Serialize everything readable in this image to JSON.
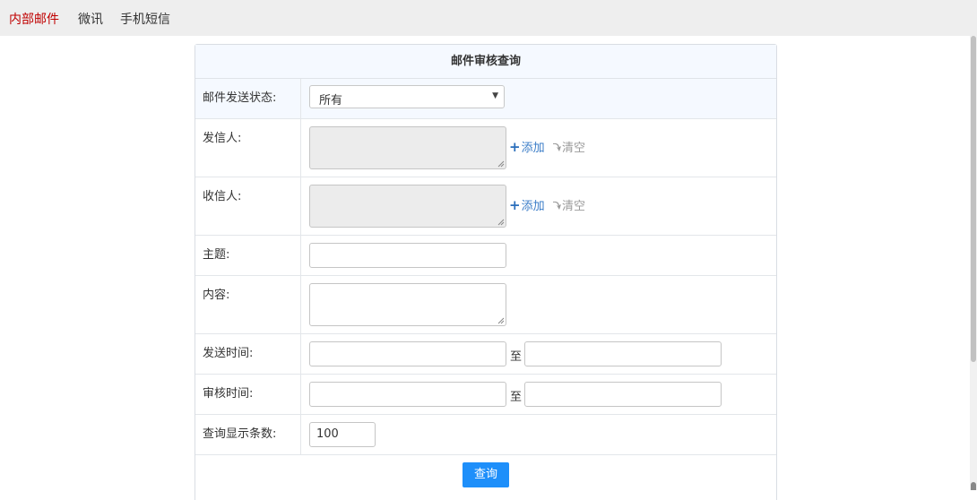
{
  "tabs": [
    {
      "label": "内部邮件",
      "active": true
    },
    {
      "label": "微讯",
      "active": false
    },
    {
      "label": "手机短信",
      "active": false
    }
  ],
  "form": {
    "title": "邮件审核查询",
    "status": {
      "label": "邮件发送状态:",
      "selected": "所有"
    },
    "sender": {
      "label": "发信人:",
      "add": "添加",
      "clear": "清空"
    },
    "receiver": {
      "label": "收信人:",
      "add": "添加",
      "clear": "清空"
    },
    "subject": {
      "label": "主题:",
      "value": ""
    },
    "content": {
      "label": "内容:",
      "value": ""
    },
    "send_time": {
      "label": "发送时间:",
      "to": "至",
      "from_value": "",
      "to_value": ""
    },
    "audit_time": {
      "label": "审核时间:",
      "to": "至",
      "from_value": "",
      "to_value": ""
    },
    "count": {
      "label": "查询显示条数:",
      "value": "100"
    },
    "query_button": "查询"
  },
  "colors": {
    "active_tab": "#c00000",
    "link": "#3a7cc7",
    "primary_button": "#1e8ffa",
    "header_bg": "#f5f9ff"
  },
  "icons": {
    "add": "plus-icon",
    "clear": "curved-arrow-icon",
    "select": "caret-down-icon"
  }
}
